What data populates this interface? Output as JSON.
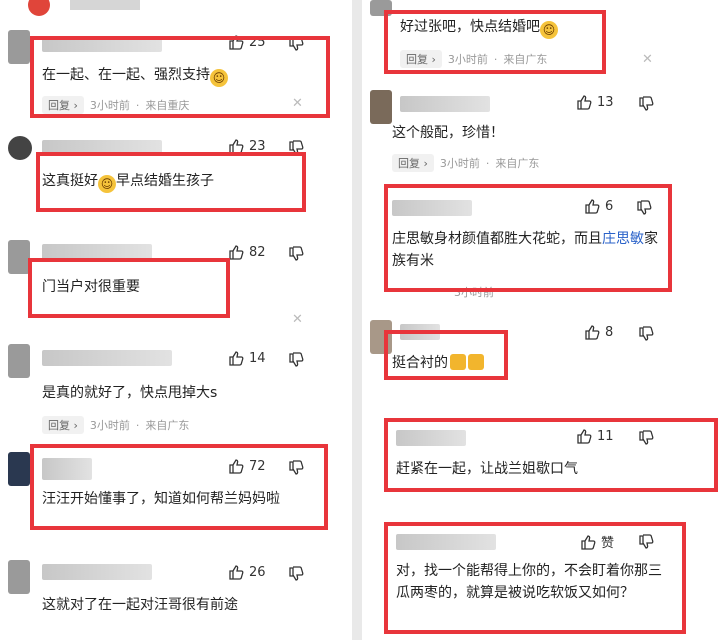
{
  "left": [
    {
      "likes": "25",
      "text": "在一起、在一起、强烈支持",
      "emoji": "grin",
      "reply": "回复",
      "time": "3小时前",
      "loc": "来自重庆"
    },
    {
      "likes": "23",
      "text": "这真挺好",
      "emoji": "grin",
      "text2": "早点结婚生孩子"
    },
    {
      "likes": "82",
      "text": "门当户对很重要"
    },
    {
      "likes": "14",
      "text": "是真的就好了，快点甩掉大s",
      "reply": "回复",
      "time": "3小时前",
      "loc": "来自广东"
    },
    {
      "likes": "72",
      "text": "汪汪开始懂事了，知道如何帮兰妈妈啦"
    },
    {
      "likes": "26",
      "text": "这就对了在一起对汪哥很有前途"
    }
  ],
  "right": [
    {
      "text": "好过张吧，快点结婚吧",
      "emoji": "grin",
      "reply": "回复",
      "time": "3小时前",
      "loc": "来自广东"
    },
    {
      "likes": "13",
      "text": "这个般配，珍惜！",
      "reply": "回复",
      "time": "3小时前",
      "loc": "来自广东"
    },
    {
      "likes": "6",
      "text_a": "庄思敏身材颜值都胜大花蛇，而且",
      "hl": "庄思敏",
      "text_b": "家族有米",
      "time": "3小时前"
    },
    {
      "likes": "8",
      "text": "挺合衬的"
    },
    {
      "likes": "11",
      "text": "赶紧在一起，让战兰姐歇口气"
    },
    {
      "likes": "赞",
      "text": "对，找一个能帮得上你的，不会盯着你那三瓜两枣的，就算是被说吃软饭又如何？"
    }
  ]
}
